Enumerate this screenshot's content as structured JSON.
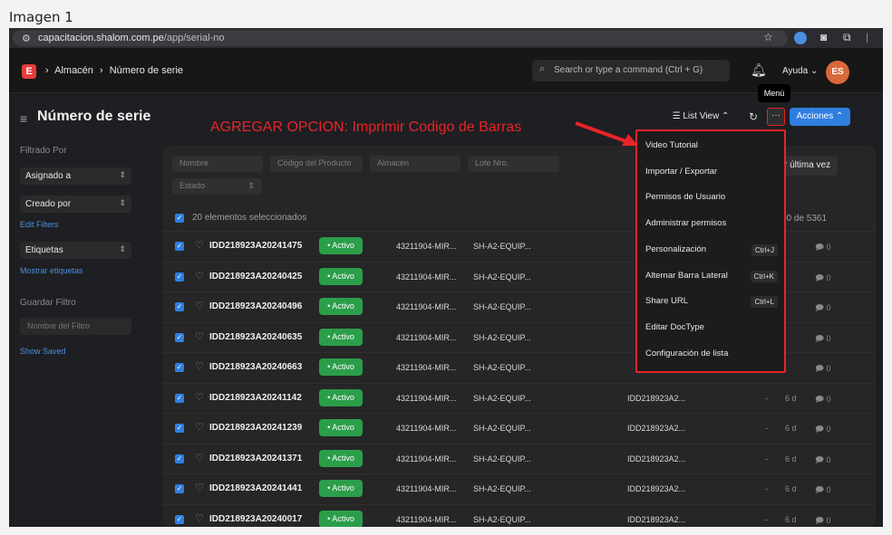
{
  "caption": "Imagen 1",
  "browser": {
    "url_domain": "capacitacion.shalom.com.pe",
    "url_path": "/app/serial-no"
  },
  "nav": {
    "breadcrumbs": [
      "Almacén",
      "Número de serie"
    ],
    "search_placeholder": "Search or type a command (Ctrl + G)",
    "help_label": "Ayuda",
    "avatar_initials": "ES",
    "tooltip": "Menú"
  },
  "page": {
    "title": "Número de serie",
    "annotation": "AGREGAR OPCION: Imprimir Codigo de Barras",
    "list_view_label": "List View",
    "actions_label": "Acciones"
  },
  "sidebar": {
    "filtered_by": "Filtrado Por",
    "assigned_to": "Asignado a",
    "created_by": "Creado por",
    "edit_filters": "Edit Filters",
    "tags": "Etiquetas",
    "show_tags": "Mostrar etiquetas",
    "save_filter": "Guardar Filtro",
    "filter_name_placeholder": "Nombre del Filtro",
    "show_saved": "Show Saved"
  },
  "filters": [
    "Nombre",
    "Código del Producto",
    "Almacén",
    "Lote Nro.",
    "Estado"
  ],
  "list": {
    "selected_text": "20 elementos seleccionados",
    "sort_label": "r última vez",
    "count_text": "20 de 5361",
    "rows": [
      {
        "serial": "IDD218923A20241475",
        "status": "• Activo",
        "c1": "43211904-MIR...",
        "c2": "SH-A2-EQUIP...",
        "c3": "",
        "age": "",
        "comments": "0"
      },
      {
        "serial": "IDD218923A20240425",
        "status": "• Activo",
        "c1": "43211904-MIR...",
        "c2": "SH-A2-EQUIP...",
        "c3": "",
        "age": "",
        "comments": "0"
      },
      {
        "serial": "IDD218923A20240496",
        "status": "• Activo",
        "c1": "43211904-MIR...",
        "c2": "SH-A2-EQUIP...",
        "c3": "",
        "age": "",
        "comments": "0"
      },
      {
        "serial": "IDD218923A20240635",
        "status": "• Activo",
        "c1": "43211904-MIR...",
        "c2": "SH-A2-EQUIP...",
        "c3": "",
        "age": "",
        "comments": "0"
      },
      {
        "serial": "IDD218923A20240663",
        "status": "• Activo",
        "c1": "43211904-MIR...",
        "c2": "SH-A2-EQUIP...",
        "c3": "",
        "age": "",
        "comments": "0"
      },
      {
        "serial": "IDD218923A20241142",
        "status": "• Activo",
        "c1": "43211904-MIR...",
        "c2": "SH-A2-EQUIP...",
        "c3": "IDD218923A2...",
        "age": "6 d",
        "comments": "0"
      },
      {
        "serial": "IDD218923A20241239",
        "status": "• Activo",
        "c1": "43211904-MIR...",
        "c2": "SH-A2-EQUIP...",
        "c3": "IDD218923A2...",
        "age": "6 d",
        "comments": "0"
      },
      {
        "serial": "IDD218923A20241371",
        "status": "• Activo",
        "c1": "43211904-MIR...",
        "c2": "SH-A2-EQUIP...",
        "c3": "IDD218923A2...",
        "age": "6 d",
        "comments": "0"
      },
      {
        "serial": "IDD218923A20241441",
        "status": "• Activo",
        "c1": "43211904-MIR...",
        "c2": "SH-A2-EQUIP...",
        "c3": "IDD218923A2...",
        "age": "6 d",
        "comments": "0"
      },
      {
        "serial": "IDD218923A20240017",
        "status": "• Activo",
        "c1": "43211904-MIR...",
        "c2": "SH-A2-EQUIP...",
        "c3": "IDD218923A2...",
        "age": "6 d",
        "comments": "0"
      }
    ]
  },
  "menu": {
    "items": [
      {
        "label": "Video Tutorial",
        "shortcut": ""
      },
      {
        "label": "Importar / Exportar",
        "shortcut": ""
      },
      {
        "label": "Permisos de Usuario",
        "shortcut": ""
      },
      {
        "label": "Administrar permisos",
        "shortcut": ""
      },
      {
        "label": "Personalización",
        "shortcut": "Ctrl+J"
      },
      {
        "label": "Alternar Barra Lateral",
        "shortcut": "Ctrl+K"
      },
      {
        "label": "Share URL",
        "shortcut": "Ctrl+L"
      },
      {
        "label": "Editar DocType",
        "shortcut": ""
      },
      {
        "label": "Configuración de lista",
        "shortcut": ""
      }
    ]
  },
  "colors": {
    "accent": "#2f7fe0",
    "status_active": "#2b9e4a",
    "annotation_red": "#e8242a",
    "logo": "#e83b3b",
    "avatar": "#d9683a"
  }
}
